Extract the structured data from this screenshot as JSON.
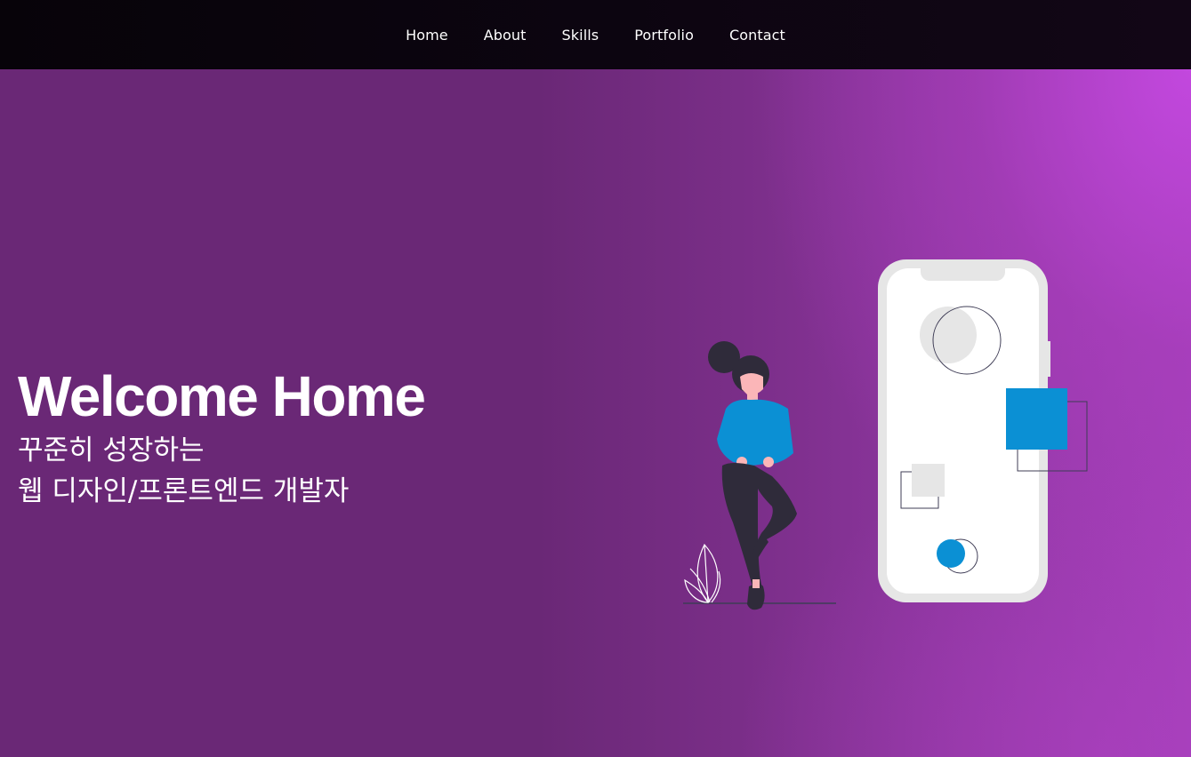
{
  "nav": {
    "items": [
      {
        "label": "Home"
      },
      {
        "label": "About"
      },
      {
        "label": "Skills"
      },
      {
        "label": "Portfolio"
      },
      {
        "label": "Contact"
      }
    ]
  },
  "hero": {
    "title": "Welcome Home",
    "subtitle_line1": "꾸준히 성장하는",
    "subtitle_line2": "웹 디자인/프론트엔드 개발자"
  },
  "colors": {
    "nav_bg": "#0a040d",
    "hero_base": "#6a2876",
    "hero_accent": "#c448e0",
    "illustration_blue": "#0b90d4",
    "phone_frame": "#e6e6e6",
    "figure_dark": "#2f2b3a",
    "skin": "#fbb6b8"
  }
}
